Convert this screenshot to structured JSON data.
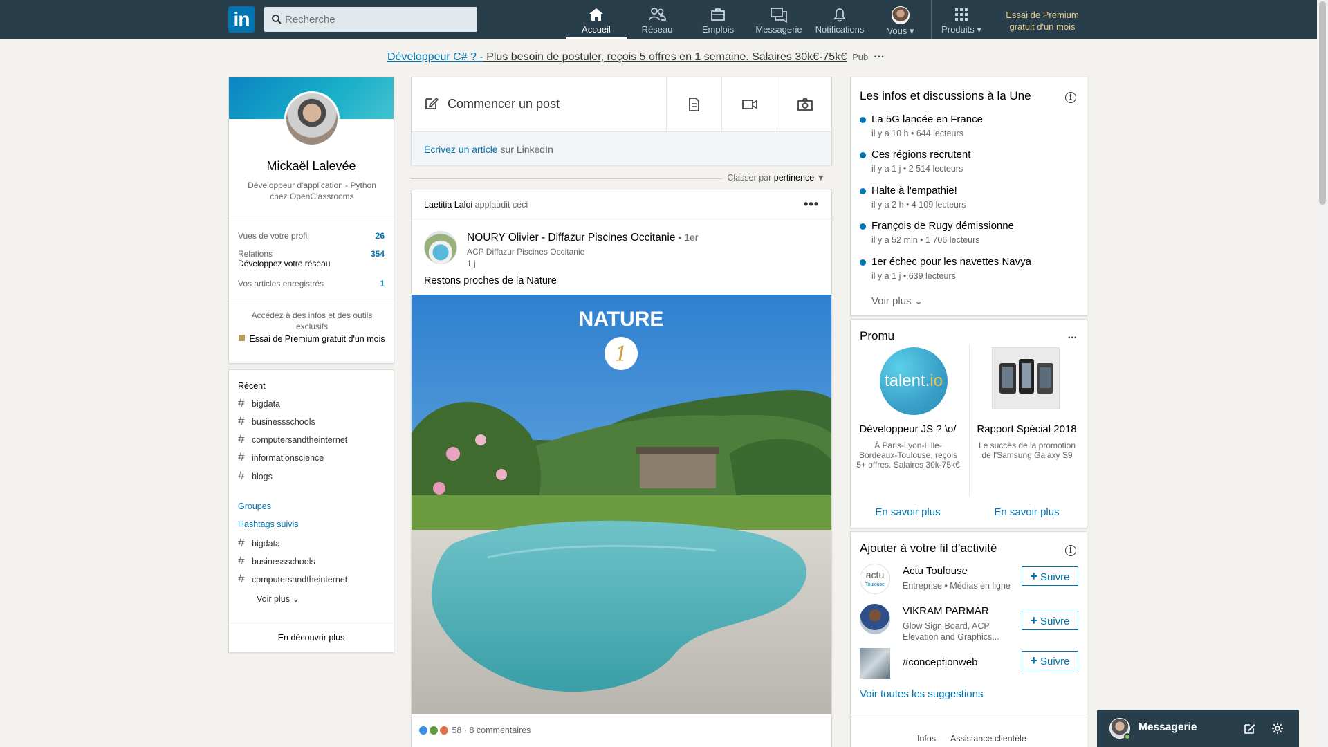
{
  "nav": {
    "logo": "in",
    "search_placeholder": "Recherche",
    "items": [
      {
        "label": "Accueil",
        "icon": "home-icon"
      },
      {
        "label": "Réseau",
        "icon": "network-icon"
      },
      {
        "label": "Emplois",
        "icon": "briefcase-icon"
      },
      {
        "label": "Messagerie",
        "icon": "chat-icon"
      },
      {
        "label": "Notifications",
        "icon": "bell-icon"
      },
      {
        "label": "Vous",
        "icon": "avatar"
      },
      {
        "label": "Produits",
        "icon": "grid-icon"
      }
    ],
    "premium": "Essai de Premium gratuit d'un mois"
  },
  "ad": {
    "link": "Développeur C# ? -",
    "text": " Plus besoin de postuler, reçois 5 offres en 1 semaine. Salaires 30k€-75k€",
    "pub": "Pub",
    "more": "···"
  },
  "profile": {
    "name": "Mickaël Lalevée",
    "title": "Développeur d'application - Python chez OpenClassrooms",
    "stats": [
      {
        "label": "Vues de votre profil",
        "value": "26"
      },
      {
        "label": "Relations",
        "sub": "Développez votre réseau",
        "value": "354"
      },
      {
        "label": "Vos articles enregistrés",
        "value": "1"
      }
    ],
    "premium_text": "Accédez à des infos et des outils exclusifs",
    "premium_link": "Essai de Premium gratuit d'un mois"
  },
  "recent": {
    "heading": "Récent",
    "tags": [
      "bigdata",
      "businessschools",
      "computersandtheinternet",
      "informationscience",
      "blogs"
    ],
    "groups": "Groupes",
    "hashtags_followed": "Hashtags suivis",
    "followed_tags": [
      "bigdata",
      "businessschools",
      "computersandtheinternet"
    ],
    "voir_plus": "Voir plus",
    "discover": "En découvrir plus"
  },
  "share": {
    "start": "Commencer un post",
    "write_link": "Écrivez un article",
    "write_rest": " sur LinkedIn",
    "sort_label": "Classer par ",
    "sort_value": "pertinence"
  },
  "post": {
    "actor": "Laetitia Laloi",
    "action": " applaudit ceci",
    "author": "NOURY Olivier - Diffazur Piscines Occitanie",
    "degree": " • 1er",
    "company": "ACP Diffazur Piscines Occitanie",
    "time": "1 j",
    "text": "Restons proches de la Nature",
    "image_title": "NATURE",
    "image_num": "1",
    "reactions": "58",
    "comments": " · 8 commentaires"
  },
  "news": {
    "title": "Les infos et discussions à la Une",
    "items": [
      {
        "title": "La 5G lancée en France",
        "meta": "il y a 10 h • 644 lecteurs"
      },
      {
        "title": "Ces régions recrutent",
        "meta": "il y a 1 j • 2 514 lecteurs"
      },
      {
        "title": "Halte à l'empathie!",
        "meta": "il y a 2 h • 4 109 lecteurs"
      },
      {
        "title": "François de Rugy démissionne",
        "meta": "il y a 52 min • 1 706 lecteurs"
      },
      {
        "title": "1er échec pour les navettes Navya",
        "meta": "il y a 1 j • 639 lecteurs"
      }
    ],
    "voir_plus": "Voir plus"
  },
  "promo": {
    "title": "Promu",
    "more": "...",
    "items": [
      {
        "logo": "talent.",
        "logo_accent": "io",
        "title": "Développeur JS ? \\o/",
        "desc": "À Paris-Lyon-Lille-Bordeaux-Toulouse, reçois 5+ offres. Salaires 30k-75k€",
        "cta": "En savoir plus"
      },
      {
        "title": "Rapport Spécial 2018",
        "desc": "Le succès de la promotion de l'Samsung Galaxy S9",
        "cta": "En savoir plus"
      }
    ]
  },
  "feed": {
    "title": "Ajouter à votre fil d’activité",
    "items": [
      {
        "name": "Actu Toulouse",
        "sub": "Entreprise • Médias en ligne",
        "logo": "actu",
        "logo_sub": "Toulouse"
      },
      {
        "name": "VIKRAM PARMAR",
        "sub": "Glow Sign Board, ACP Elevation and Graphics..."
      },
      {
        "name": "#conceptionweb",
        "sub": ""
      }
    ],
    "follow_label": "Suivre",
    "all_suggestions": "Voir toutes les suggestions"
  },
  "footer": {
    "links": [
      "Infos",
      "Assistance clientèle"
    ]
  },
  "messaging": {
    "title": "Messagerie"
  },
  "colors": {
    "nav_bg": "#283e4a",
    "accent": "#0073b1",
    "premium": "#e7c98a"
  }
}
